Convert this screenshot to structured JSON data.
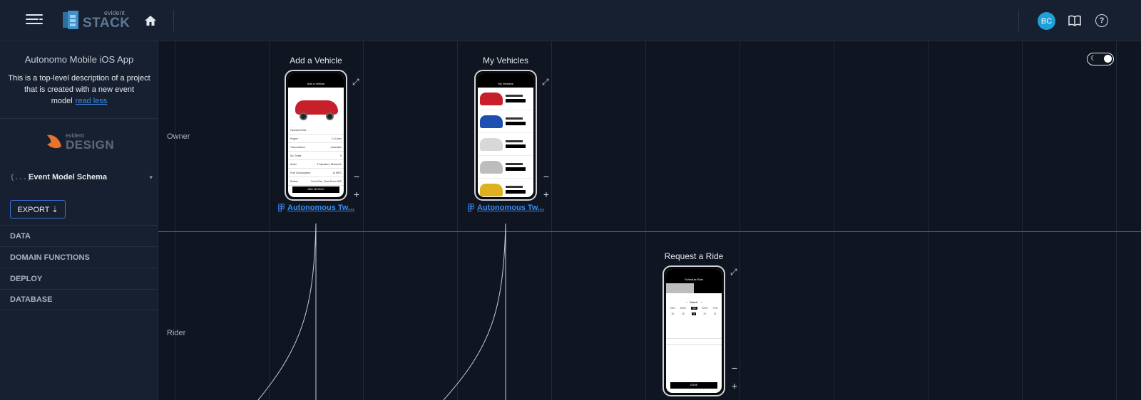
{
  "app": {
    "logo_small": "evident",
    "logo_big": "STACK",
    "avatar_initials": "BC",
    "accent_color": "#1fa0d8",
    "link_color": "#3a8cf0"
  },
  "sidebar": {
    "project_title": "Autonomo Mobile iOS App",
    "project_description": "This is a top-level description of a project that is created with a new event model",
    "read_less": "read less",
    "design_logo_small": "evident",
    "design_logo_big": "DESIGN",
    "schema_icon": "{...}",
    "schema_label": "Event Model Schema",
    "schema_caret": "▾",
    "export_label": "EXPORT ⇣",
    "nav_items": [
      {
        "label": "DATA"
      },
      {
        "label": "DOMAIN FUNCTIONS"
      },
      {
        "label": "DEPLOY"
      },
      {
        "label": "DATABASE"
      }
    ]
  },
  "canvas": {
    "lanes": [
      {
        "label": "Owner"
      },
      {
        "label": "Rider"
      }
    ],
    "screens": [
      {
        "title": "Add a Vehicle",
        "header": "Add a Vehicle",
        "vehicle_name": "Hyundai Creta",
        "rows": [
          {
            "k": "Engine",
            "v": "1.4 Litres"
          },
          {
            "k": "Transmission",
            "v": "Automatic"
          },
          {
            "k": "No. Seats",
            "v": "5"
          },
          {
            "k": "Audio",
            "v": "5 Speakers, Bluetooth"
          },
          {
            "k": "Fuel Consumption",
            "v": "13 MPG"
          },
          {
            "k": "Brakes",
            "v": "Front Disc, Rear Drum ABS"
          }
        ],
        "button": "ADD VEHICLE",
        "link": "Autonomous Tw..."
      },
      {
        "title": "My Vehicles",
        "header": "My Vehicles",
        "link": "Autonomous Tw..."
      },
      {
        "title": "Request a Ride",
        "header": "Schedule Ride",
        "month": "March",
        "days": [
          "SUN",
          "MON",
          "TUE",
          "WED",
          "THU"
        ],
        "dates": [
          "16",
          "18",
          "19",
          "20",
          "21"
        ],
        "button": "DONE"
      }
    ]
  }
}
